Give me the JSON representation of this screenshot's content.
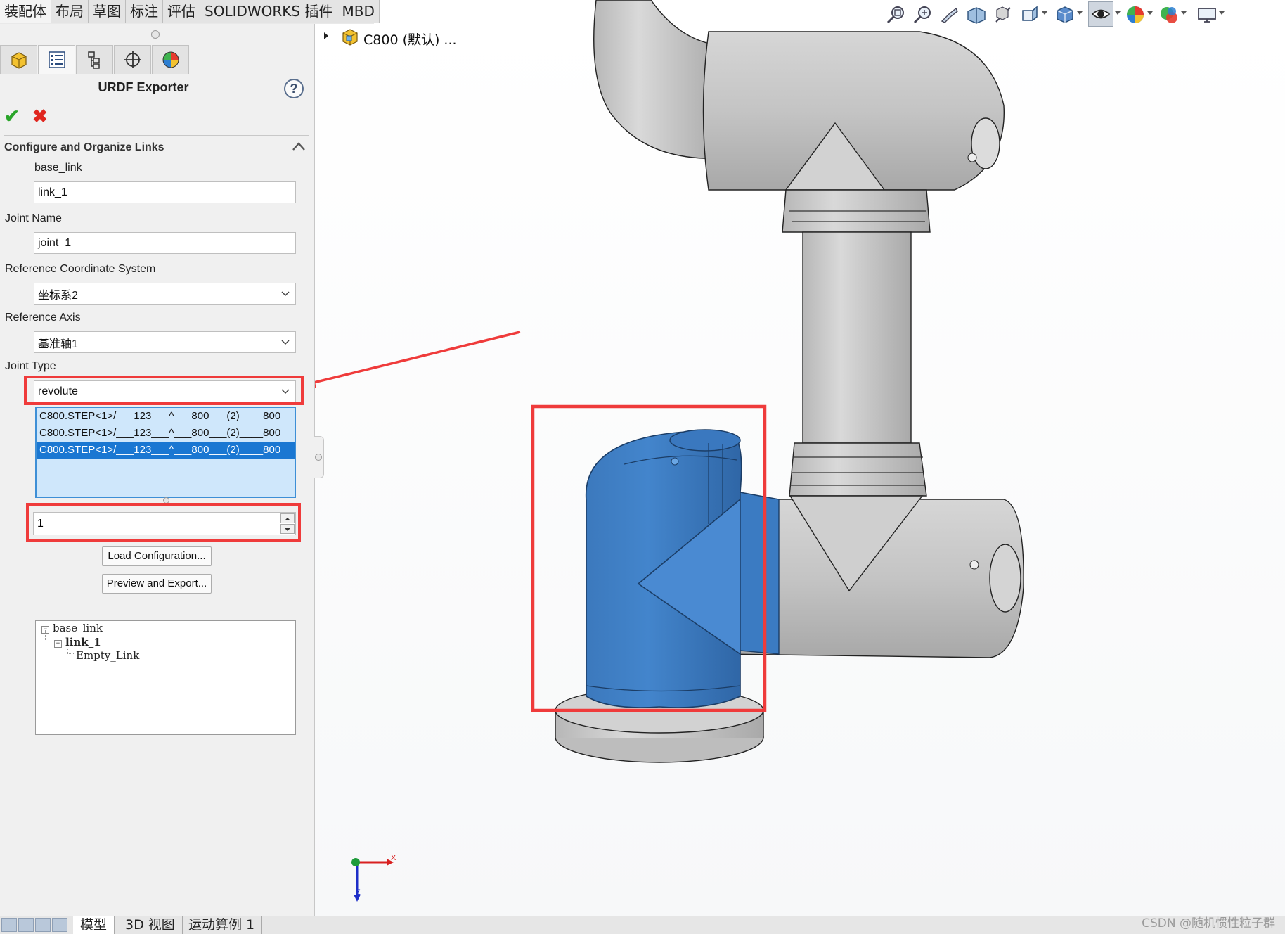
{
  "cmd_tabs": [
    "装配体",
    "布局",
    "草图",
    "标注",
    "评估",
    "SOLIDWORKS 插件",
    "MBD"
  ],
  "tree_root": {
    "label": "C800 (默认) ..."
  },
  "panel": {
    "title": "URDF Exporter",
    "help": "?",
    "section_title": "Configure and Organize Links",
    "link_name_label": "base_link",
    "link_name_value": "link_1",
    "joint_name_label": "Joint Name",
    "joint_name_value": "joint_1",
    "ref_coord_label": "Reference Coordinate System",
    "ref_coord_value": "坐标系2",
    "ref_axis_label": "Reference Axis",
    "ref_axis_value": "基准轴1",
    "joint_type_label": "Joint Type",
    "joint_type_value": "revolute",
    "components": [
      "C800.STEP<1>/___123___^___800___(2)____800",
      "C800.STEP<1>/___123___^___800___(2)____800",
      "C800.STEP<1>/___123___^___800___(2)____800"
    ],
    "selected_component_index": 2,
    "child_count_value": "1",
    "load_config_label": "Load Configuration...",
    "preview_export_label": "Preview and Export...",
    "link_tree": {
      "root": "base_link",
      "child": "link_1",
      "grandchild": "Empty_Link"
    }
  },
  "bottom_tabs": [
    "模型",
    "3D 视图",
    "运动算例 1"
  ],
  "triad": {
    "x_label": "X",
    "z_label": "Z"
  },
  "watermark": "CSDN @随机惯性粒子群",
  "colors": {
    "highlight_blue": "#3a78bf",
    "robot_gray": "#c9c9c9",
    "annotation_red": "#ef3b3b",
    "ok_green": "#2aa52a",
    "cancel_red": "#e0261f"
  },
  "toolbar_icons": [
    "zoom-to-fit-icon",
    "zoom-area-icon",
    "previous-view-icon",
    "section-view-icon",
    "dynamic-annotation-icon",
    "view-orientation-icon",
    "display-style-icon",
    "hide-show-items-icon",
    "edit-appearance-icon",
    "apply-scene-icon",
    "view-settings-icon"
  ]
}
